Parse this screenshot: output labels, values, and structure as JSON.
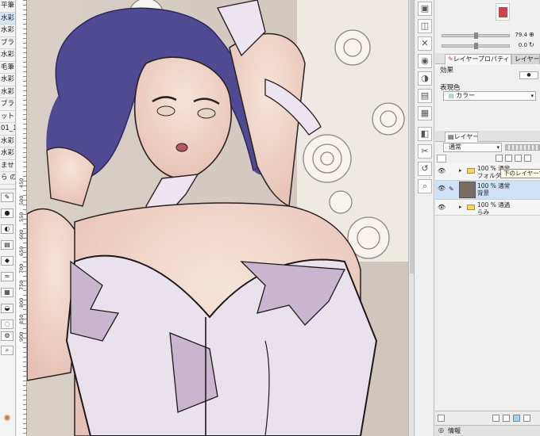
{
  "brushes": [
    "平筆",
    "水彩",
    "水彩",
    "ブラシ",
    "水彩",
    "毛筆",
    "水彩",
    "水彩",
    "ブラシ",
    "ット1",
    "01_1",
    "水彩",
    "水彩",
    "ませ",
    "ら の"
  ],
  "ruler_labels": [
    "450",
    "500",
    "550",
    "600",
    "650",
    "700",
    "750",
    "800",
    "850",
    "900"
  ],
  "navigator": {
    "zoom": "79.4",
    "angle": "0.0"
  },
  "property_tabs": {
    "layer_property": "レイヤープロパティ",
    "layer_search": "レイヤー検"
  },
  "effects": {
    "section_label": "効果",
    "display_color_label": "表現色",
    "display_color_value": "カラー"
  },
  "layer_panel": {
    "tab_label": "レイヤー",
    "blend_mode": "通常"
  },
  "layers": [
    {
      "line1": "100 % 通常",
      "line2": "フォルダー",
      "type": "folder"
    },
    {
      "line1": "100 % 通常",
      "line2": "背景",
      "type": "raster"
    },
    {
      "line1": "100 % 通過",
      "line2": "らみ",
      "type": "folder"
    }
  ],
  "tooltip": "下のレイヤーで",
  "bottom_tab": "情報",
  "colors": {
    "hair": "#4f4a92",
    "skin": "#efd3c4",
    "panel": "#f0f0f0",
    "selection": "#cfe2f5",
    "accent": "#c9444f"
  }
}
